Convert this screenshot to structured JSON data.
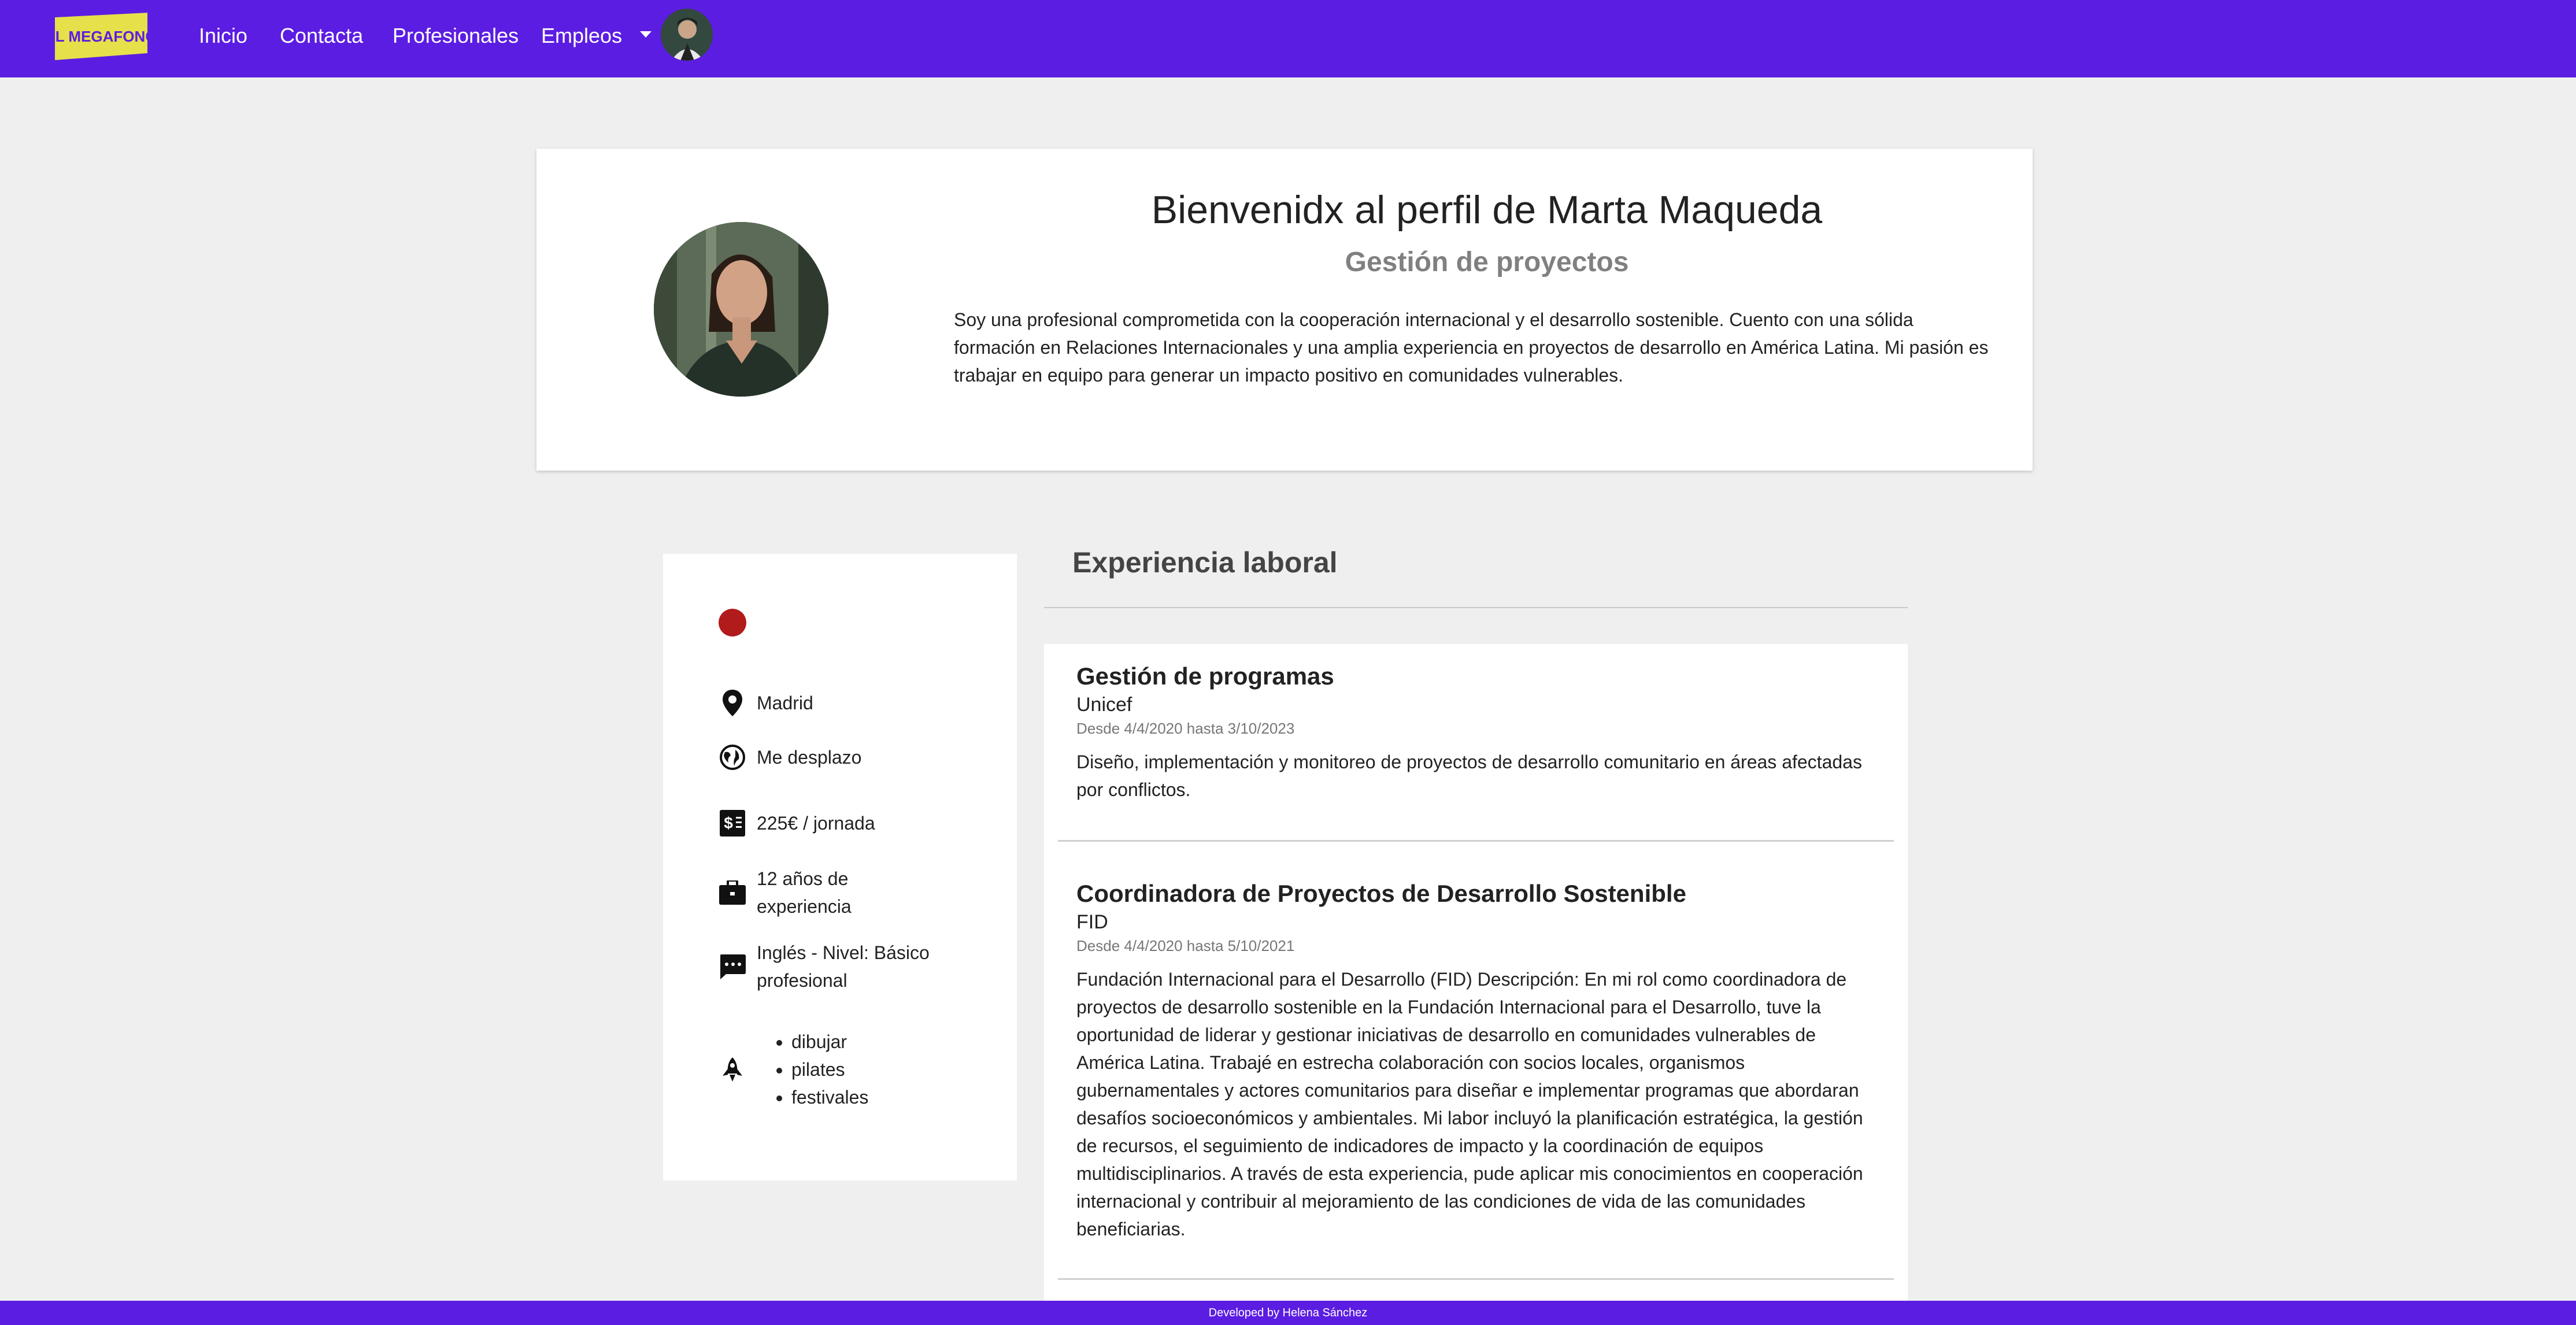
{
  "nav": {
    "logo_text": "EL MEGAFONO",
    "links": [
      "Inicio",
      "Contacta",
      "Profesionales",
      "Empleos"
    ]
  },
  "profile": {
    "greeting": "Bienvenidx al perfil de Marta Maqueda",
    "role": "Gestión de proyectos",
    "bio": "Soy una profesional comprometida con la cooperación internacional y el desarrollo sostenible. Cuento con una sólida formación en Relaciones Internacionales y una amplia experiencia en proyectos de desarrollo en América Latina. Mi pasión es trabajar en equipo para generar un impacto positivo en comunidades vulnerables."
  },
  "sidebar": {
    "status_color": "#b11b1b",
    "location": "Madrid",
    "mobility": "Me desplazo",
    "rate": "225€ / jornada",
    "experience": "12 años de experiencia",
    "language": "Inglés - Nivel: Básico profesional",
    "hobbies": [
      "dibujar",
      "pilates",
      "festivales"
    ]
  },
  "experience": {
    "heading": "Experiencia laboral",
    "jobs": [
      {
        "title": "Gestión de programas",
        "company": "Unicef",
        "dates": "Desde 4/4/2020 hasta 3/10/2023",
        "description": "Diseño, implementación y monitoreo de proyectos de desarrollo comunitario en áreas afectadas por conflictos."
      },
      {
        "title": "Coordinadora de Proyectos de Desarrollo Sostenible",
        "company": "FID",
        "dates": "Desde 4/4/2020 hasta 5/10/2021",
        "description": "Fundación Internacional para el Desarrollo (FID) Descripción: En mi rol como coordinadora de proyectos de desarrollo sostenible en la Fundación Internacional para el Desarrollo, tuve la oportunidad de liderar y gestionar iniciativas de desarrollo en comunidades vulnerables de América Latina. Trabajé en estrecha colaboración con socios locales, organismos gubernamentales y actores comunitarios para diseñar e implementar programas que abordaran desafíos socioeconómicos y ambientales. Mi labor incluyó la planificación estratégica, la gestión de recursos, el seguimiento de indicadores de impacto y la coordinación de equipos multidisciplinarios. A través de esta experiencia, pude aplicar mis conocimientos en cooperación internacional y contribuir al mejoramiento de las condiciones de vida de las comunidades beneficiarias."
      }
    ]
  },
  "footer": {
    "credit": "Developed by Helena Sánchez"
  },
  "colors": {
    "brand": "#5c1de2",
    "logo_yellow": "#e6e04a"
  }
}
